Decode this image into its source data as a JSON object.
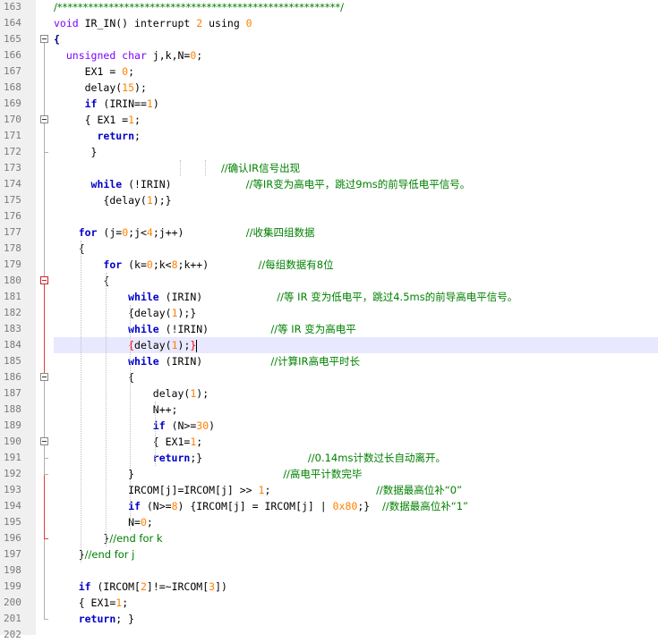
{
  "editor": {
    "lines": [
      {
        "n": "163",
        "indent": 0,
        "tokens": [
          [
            "cm",
            "/*******************************************************/"
          ]
        ]
      },
      {
        "n": "164",
        "indent": 0,
        "tokens": [
          [
            "ty",
            "void"
          ],
          [
            "tx",
            " IR_IN() interrupt "
          ],
          [
            "num",
            "2"
          ],
          [
            "tx",
            " using "
          ],
          [
            "num",
            "0"
          ]
        ]
      },
      {
        "n": "165",
        "indent": 0,
        "tokens": [
          [
            "op",
            "{"
          ]
        ]
      },
      {
        "n": "166",
        "indent": 2,
        "tokens": [
          [
            "ty",
            "unsigned char"
          ],
          [
            "tx",
            " j,k,N="
          ],
          [
            "num",
            "0"
          ],
          [
            "tx",
            ";"
          ]
        ]
      },
      {
        "n": "167",
        "indent": 5,
        "tokens": [
          [
            "tx",
            "EX1 = "
          ],
          [
            "num",
            "0"
          ],
          [
            "tx",
            ";"
          ]
        ]
      },
      {
        "n": "168",
        "indent": 5,
        "tokens": [
          [
            "tx",
            "delay("
          ],
          [
            "num",
            "15"
          ],
          [
            "tx",
            ");"
          ]
        ]
      },
      {
        "n": "169",
        "indent": 5,
        "tokens": [
          [
            "kw",
            "if"
          ],
          [
            "tx",
            " (IRIN=="
          ],
          [
            "num",
            "1"
          ],
          [
            "tx",
            ")"
          ]
        ]
      },
      {
        "n": "170",
        "indent": 5,
        "tokens": [
          [
            "tx",
            "{ EX1 ="
          ],
          [
            "num",
            "1"
          ],
          [
            "tx",
            ";"
          ]
        ]
      },
      {
        "n": "171",
        "indent": 7,
        "tokens": [
          [
            "kw",
            "return"
          ],
          [
            "tx",
            ";"
          ]
        ]
      },
      {
        "n": "172",
        "indent": 6,
        "tokens": [
          [
            "tx",
            "}"
          ]
        ]
      },
      {
        "n": "173",
        "indent": 27,
        "tokens": [
          [
            "cm",
            "//确认IR信号出现"
          ]
        ]
      },
      {
        "n": "174",
        "indent": 6,
        "tokens": [
          [
            "kw",
            "while"
          ],
          [
            "tx",
            " (!IRIN)            "
          ],
          [
            "cm",
            "//等IR变为高电平，跳过9ms的前导低电平信号。"
          ]
        ]
      },
      {
        "n": "175",
        "indent": 8,
        "tokens": [
          [
            "tx",
            "{delay("
          ],
          [
            "num",
            "1"
          ],
          [
            "tx",
            ");}"
          ]
        ]
      },
      {
        "n": "176",
        "indent": 0,
        "tokens": []
      },
      {
        "n": "177",
        "indent": 4,
        "tokens": [
          [
            "kw",
            "for"
          ],
          [
            "tx",
            " (j="
          ],
          [
            "num",
            "0"
          ],
          [
            "tx",
            ";j<"
          ],
          [
            "num",
            "4"
          ],
          [
            "tx",
            ";j++)          "
          ],
          [
            "cm",
            "//收集四组数据"
          ]
        ]
      },
      {
        "n": "178",
        "indent": 4,
        "tokens": [
          [
            "tx",
            "{"
          ]
        ]
      },
      {
        "n": "179",
        "indent": 8,
        "tokens": [
          [
            "kw",
            "for"
          ],
          [
            "tx",
            " (k="
          ],
          [
            "num",
            "0"
          ],
          [
            "tx",
            ";k<"
          ],
          [
            "num",
            "8"
          ],
          [
            "tx",
            ";k++)        "
          ],
          [
            "cm",
            "//每组数据有8位"
          ]
        ]
      },
      {
        "n": "180",
        "indent": 8,
        "tokens": [
          [
            "tx",
            "{"
          ]
        ]
      },
      {
        "n": "181",
        "indent": 12,
        "tokens": [
          [
            "kw",
            "while"
          ],
          [
            "tx",
            " (IRIN)            "
          ],
          [
            "cm",
            "//等 IR 变为低电平，跳过4.5ms的前导高电平信号。"
          ]
        ]
      },
      {
        "n": "182",
        "indent": 12,
        "tokens": [
          [
            "tx",
            "{delay("
          ],
          [
            "num",
            "1"
          ],
          [
            "tx",
            ");}"
          ]
        ]
      },
      {
        "n": "183",
        "indent": 12,
        "tokens": [
          [
            "kw",
            "while"
          ],
          [
            "tx",
            " (!IRIN)          "
          ],
          [
            "cm",
            "//等 IR 变为高电平"
          ]
        ]
      },
      {
        "n": "184",
        "indent": 12,
        "tokens": [
          [
            "hlbr",
            "{"
          ],
          [
            "tx",
            "delay("
          ],
          [
            "num",
            "1"
          ],
          [
            "tx",
            ");"
          ],
          [
            "hlbr",
            "}"
          ]
        ]
      },
      {
        "n": "185",
        "indent": 12,
        "tokens": [
          [
            "kw",
            "while"
          ],
          [
            "tx",
            " (IRIN)           "
          ],
          [
            "cm",
            "//计算IR高电平时长"
          ]
        ]
      },
      {
        "n": "186",
        "indent": 12,
        "tokens": [
          [
            "tx",
            "{"
          ]
        ]
      },
      {
        "n": "187",
        "indent": 16,
        "tokens": [
          [
            "tx",
            "delay("
          ],
          [
            "num",
            "1"
          ],
          [
            "tx",
            ");"
          ]
        ]
      },
      {
        "n": "188",
        "indent": 16,
        "tokens": [
          [
            "tx",
            "N++;"
          ]
        ]
      },
      {
        "n": "189",
        "indent": 16,
        "tokens": [
          [
            "kw",
            "if"
          ],
          [
            "tx",
            " (N>="
          ],
          [
            "num",
            "30"
          ],
          [
            "tx",
            ")"
          ]
        ]
      },
      {
        "n": "190",
        "indent": 16,
        "tokens": [
          [
            "tx",
            "{ EX1="
          ],
          [
            "num",
            "1"
          ],
          [
            "tx",
            ";"
          ]
        ]
      },
      {
        "n": "191",
        "indent": 16,
        "tokens": [
          [
            "kw",
            "return"
          ],
          [
            "tx",
            ";}                 "
          ],
          [
            "cm",
            "//0.14ms计数过长自动离开。"
          ]
        ]
      },
      {
        "n": "192",
        "indent": 12,
        "tokens": [
          [
            "tx",
            "}                        "
          ],
          [
            "cm",
            "//高电平计数完毕"
          ]
        ]
      },
      {
        "n": "193",
        "indent": 12,
        "tokens": [
          [
            "tx",
            "IRCOM[j]=IRCOM[j] >> "
          ],
          [
            "num",
            "1"
          ],
          [
            "tx",
            ";                 "
          ],
          [
            "cm",
            "//数据最高位补“0”"
          ]
        ]
      },
      {
        "n": "194",
        "indent": 12,
        "tokens": [
          [
            "kw",
            "if"
          ],
          [
            "tx",
            " (N>="
          ],
          [
            "num",
            "8"
          ],
          [
            "tx",
            ") {IRCOM[j] = IRCOM[j] | "
          ],
          [
            "num",
            "0x80"
          ],
          [
            "tx",
            ";}  "
          ],
          [
            "cm",
            "//数据最高位补“1”"
          ]
        ]
      },
      {
        "n": "195",
        "indent": 12,
        "tokens": [
          [
            "tx",
            "N="
          ],
          [
            "num",
            "0"
          ],
          [
            "tx",
            ";"
          ]
        ]
      },
      {
        "n": "196",
        "indent": 8,
        "tokens": [
          [
            "tx",
            "}"
          ],
          [
            "cm",
            "//end for k"
          ]
        ]
      },
      {
        "n": "197",
        "indent": 4,
        "tokens": [
          [
            "tx",
            "}"
          ],
          [
            "cm",
            "//end for j"
          ]
        ]
      },
      {
        "n": "198",
        "indent": 0,
        "tokens": []
      },
      {
        "n": "199",
        "indent": 4,
        "tokens": [
          [
            "kw",
            "if"
          ],
          [
            "tx",
            " (IRCOM["
          ],
          [
            "num",
            "2"
          ],
          [
            "tx",
            "]!=~IRCOM["
          ],
          [
            "num",
            "3"
          ],
          [
            "tx",
            "])"
          ]
        ]
      },
      {
        "n": "200",
        "indent": 4,
        "tokens": [
          [
            "tx",
            "{ EX1="
          ],
          [
            "num",
            "1"
          ],
          [
            "tx",
            ";"
          ]
        ]
      },
      {
        "n": "201",
        "indent": 4,
        "tokens": [
          [
            "kw",
            "return"
          ],
          [
            "tx",
            "; }"
          ]
        ]
      },
      {
        "n": "202",
        "indent": 0,
        "tokens": []
      }
    ],
    "highlighted_line": "184",
    "fold_markers": [
      "165",
      "170",
      "180",
      "186",
      "190"
    ]
  }
}
